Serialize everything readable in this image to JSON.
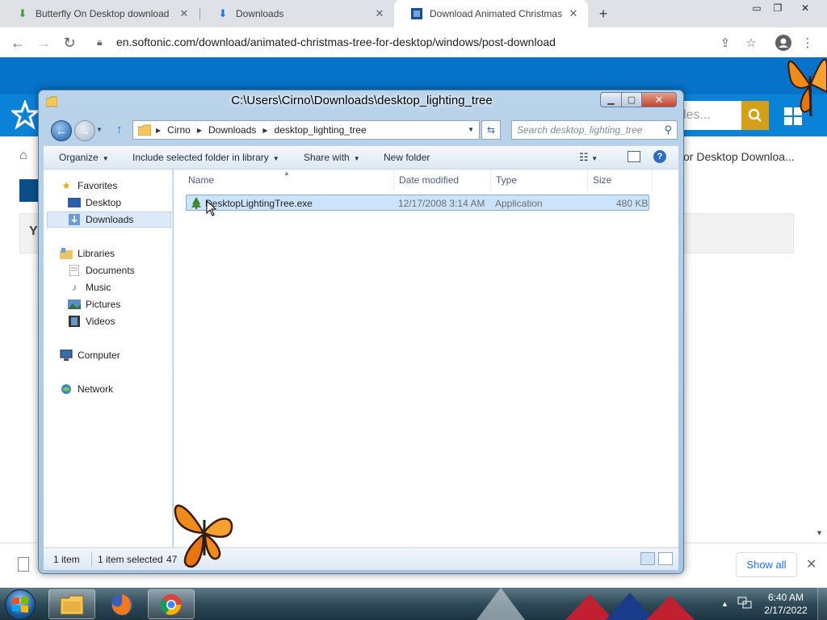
{
  "browser": {
    "tabs": [
      {
        "label": "Butterfly On Desktop download ,",
        "icon": "download-arrow-icon"
      },
      {
        "label": "Downloads",
        "icon": "download-icon"
      },
      {
        "label": "Download Animated Christmas T",
        "icon": "softonic-icon"
      }
    ],
    "url": "en.softonic.com/download/animated-christmas-tree-for-desktop/windows/post-download"
  },
  "webpage": {
    "search_placeholder": "les...",
    "breadcrumb_tail": "or Desktop Downloa...",
    "box_text": "Y"
  },
  "download_shelf": {
    "show_all": "Show all"
  },
  "explorer": {
    "title": "C:\\Users\\Cirno\\Downloads\\desktop_lighting_tree",
    "address": [
      "Cirno",
      "Downloads",
      "desktop_lighting_tree"
    ],
    "search_placeholder": "Search desktop_lighting_tree",
    "commands": {
      "organize": "Organize",
      "include": "Include selected folder in library",
      "share": "Share with",
      "new_folder": "New folder"
    },
    "nav": {
      "favorites": "Favorites",
      "desktop": "Desktop",
      "downloads": "Downloads",
      "libraries": "Libraries",
      "documents": "Documents",
      "music": "Music",
      "pictures": "Pictures",
      "videos": "Videos",
      "computer": "Computer",
      "network": "Network"
    },
    "columns": {
      "name": "Name",
      "date": "Date modified",
      "type": "Type",
      "size": "Size"
    },
    "files": [
      {
        "name": "DesktopLightingTree.exe",
        "date": "12/17/2008 3:14 AM",
        "type": "Application",
        "size": "480 KB"
      }
    ],
    "status": {
      "count": "1 item",
      "selected": "1 item selected",
      "size_partial": "47"
    }
  },
  "taskbar": {
    "time": "6:40 AM",
    "date": "2/17/2022"
  },
  "colors": {
    "page_banner": "#0672c9",
    "accent_search": "#d4a017",
    "selection": "#cce4fa"
  }
}
